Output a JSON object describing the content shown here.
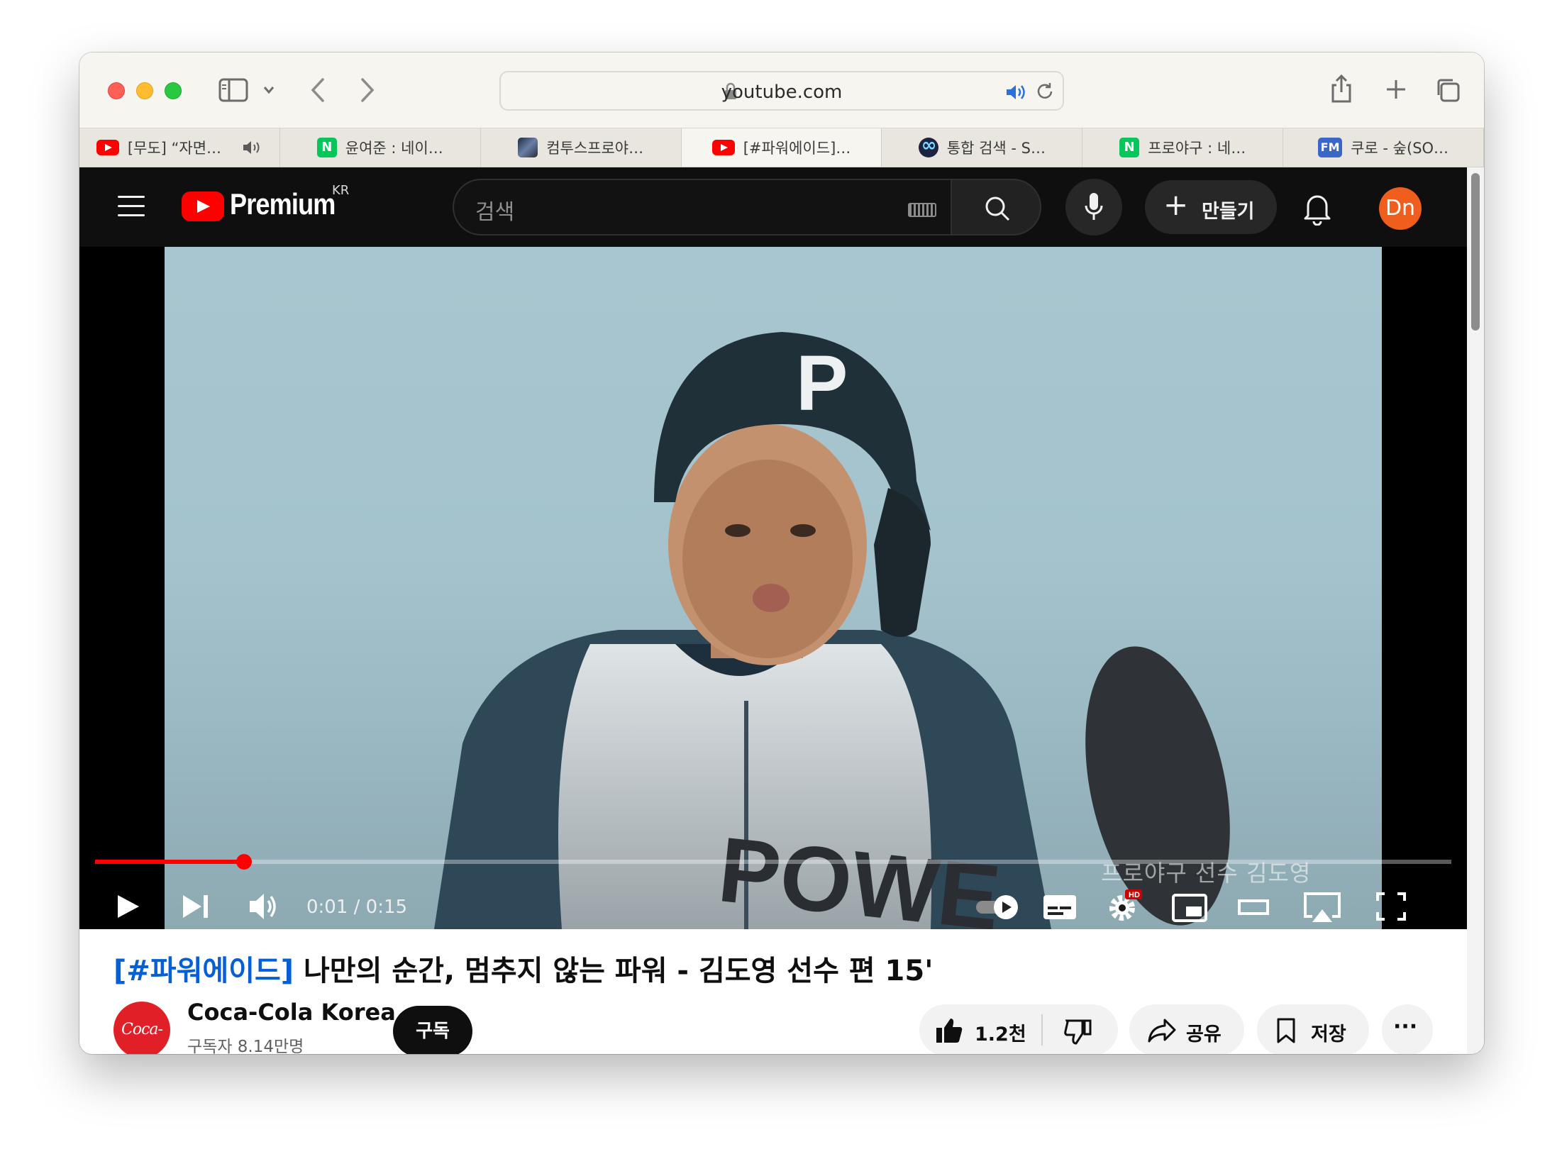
{
  "browser": {
    "url": "youtube.com",
    "tabs": [
      {
        "favicon": "youtube-icon",
        "title": "[무도] “자면…",
        "audio": true
      },
      {
        "favicon": "naver-icon",
        "title": "윤여준 : 네이…"
      },
      {
        "favicon": "game-icon",
        "title": "컴투스프로야…"
      },
      {
        "favicon": "youtube-icon",
        "title": "[#파워에이드]…",
        "active": true
      },
      {
        "favicon": "loop-icon",
        "title": "통합 검색 - S…"
      },
      {
        "favicon": "naver-icon",
        "title": "프로야구 : 네…"
      },
      {
        "favicon": "fm-icon",
        "title": "쿠로 - 숲(SO…"
      }
    ],
    "naver_letter": "N",
    "fm_letter": "FM"
  },
  "youtube": {
    "brand": "Premium",
    "region": "KR",
    "search_placeholder": "검색",
    "create_label": "만들기",
    "avatar_initials": "Dn",
    "avatar_color": "#ef5e1c"
  },
  "player": {
    "current_time": "0:01",
    "duration": "0:15",
    "time_display": "0:01 / 0:15",
    "progress_fraction": 0.11,
    "subtitle_overlay": "프로야구 선수 김도영",
    "hd_badge": "HD"
  },
  "video": {
    "title_tag": "[#파워에이드]",
    "title_rest": " 나만의 순간, 멈추지 않는 파워 - 김도영 선수 편 15'",
    "channel_logo_text": "Coca-Cola",
    "channel_name": "Coca-Cola Korea",
    "subscribers": "구독자 8.14만명",
    "subscribe_label": "구독",
    "likes": "1.2천",
    "share_label": "공유",
    "save_label": "저장",
    "more_label": "···"
  }
}
